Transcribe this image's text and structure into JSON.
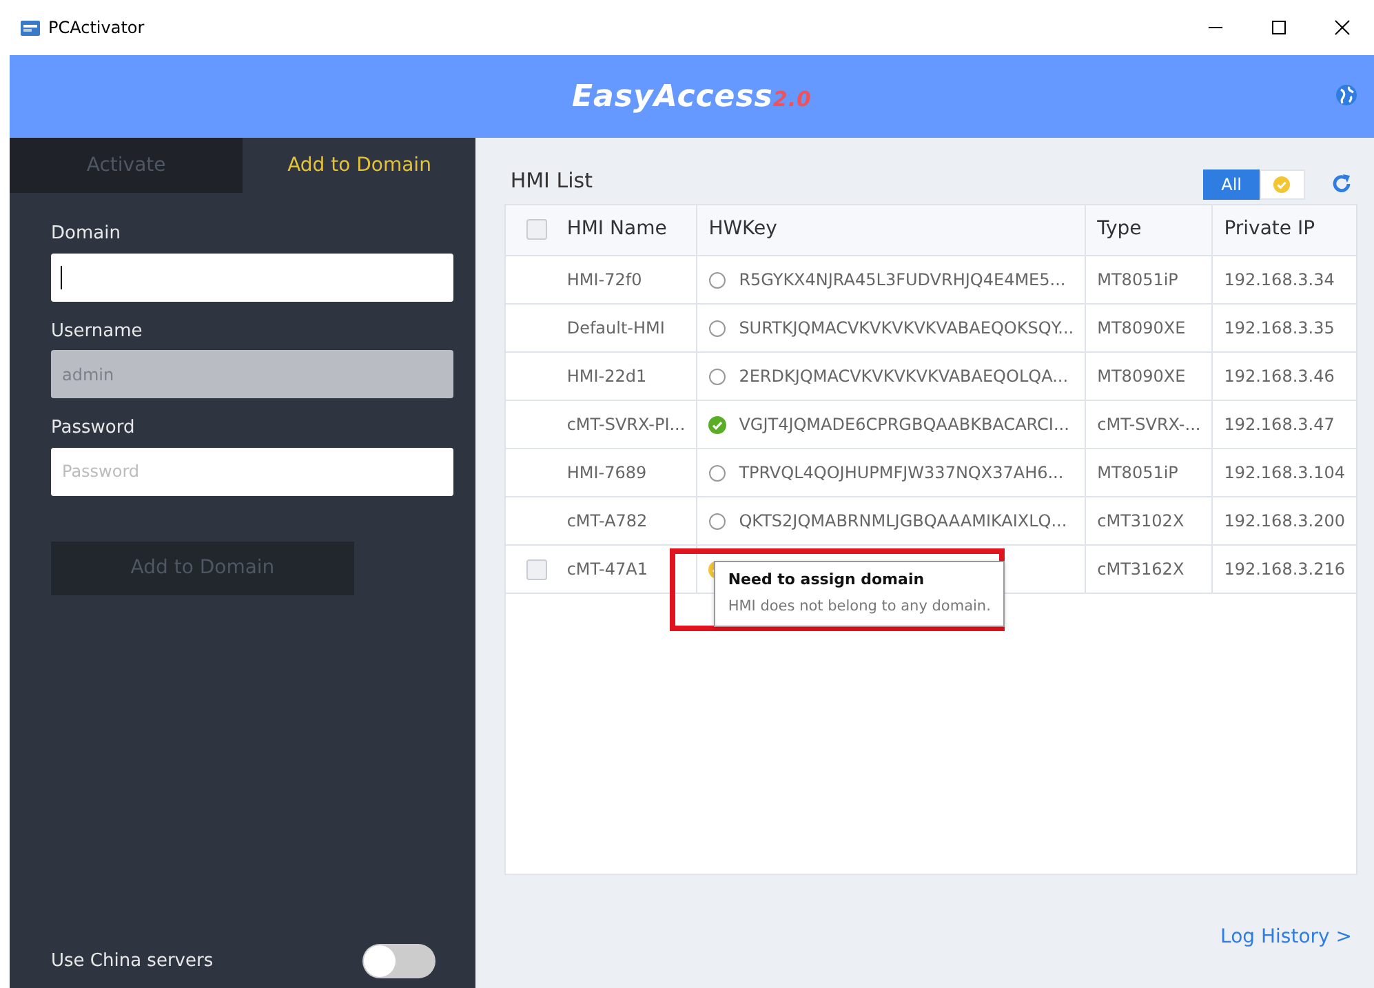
{
  "window": {
    "title": "PCActivator"
  },
  "header": {
    "logo_text": "EasyAccess",
    "logo_version": "2.0"
  },
  "sidebar": {
    "tabs": [
      {
        "label": "Activate",
        "selected": false
      },
      {
        "label": "Add to Domain",
        "selected": true
      }
    ],
    "fields": [
      {
        "label": "Domain",
        "focused": true,
        "disabled": false
      },
      {
        "label": "Username",
        "value": "admin",
        "focused": false,
        "disabled": true
      },
      {
        "label": "Password",
        "placeholder": "Password",
        "focused": false,
        "disabled": false
      }
    ],
    "submit_button": {
      "label": "Add to Domain",
      "disabled": true
    },
    "china_servers": {
      "label": "Use China servers",
      "on": false
    }
  },
  "hmi_list": {
    "title": "HMI List",
    "filters": [
      {
        "kind": "text",
        "label": "All",
        "selected": true
      },
      {
        "kind": "warn",
        "selected": false
      }
    ],
    "columns": [
      "HMI Name",
      "HWKey",
      "Type",
      "Private IP"
    ],
    "header_checked": false,
    "rows": [
      {
        "name": "HMI-72f0",
        "kind": "none",
        "hwkey": "R5GYKX4NJRA45L3FUDVRHJQ4E4ME5...",
        "type": "MT8051iP",
        "ip": "192.168.3.34"
      },
      {
        "name": "Default-HMI",
        "kind": "none",
        "hwkey": "SURTKJQMACVKVKVKVKVABAEQOKSQY...",
        "type": "MT8090XE",
        "ip": "192.168.3.35"
      },
      {
        "name": "HMI-22d1",
        "kind": "none",
        "hwkey": "2ERDKJQMACVKVKVKVKVABAEQOLQA...",
        "type": "MT8090XE",
        "ip": "192.168.3.46"
      },
      {
        "name": "cMT-SVRX-PI...",
        "kind": "ok",
        "hwkey": "VGJT4JQMADE6CPRGBQAABKBACARCI...",
        "type": "cMT-SVRX-...",
        "ip": "192.168.3.47"
      },
      {
        "name": "HMI-7689",
        "kind": "none",
        "hwkey": "TPRVQL4QOJHUPMFJW337NQX37AH6...",
        "type": "MT8051iP",
        "ip": "192.168.3.104"
      },
      {
        "name": "cMT-A782",
        "kind": "none",
        "hwkey": "QKTS2JQMABRNMLJGBQAAAMIKAIXLQ...",
        "type": "cMT3102X",
        "ip": "192.168.3.200"
      },
      {
        "name": "cMT-47A1",
        "kind": "warn",
        "checked": false,
        "type": "cMT3162X",
        "ip": "192.168.3.216"
      }
    ],
    "tooltip": {
      "title": "Need to assign domain",
      "text": "HMI does not belong to any domain."
    }
  },
  "log_history_link": "Log History >"
}
